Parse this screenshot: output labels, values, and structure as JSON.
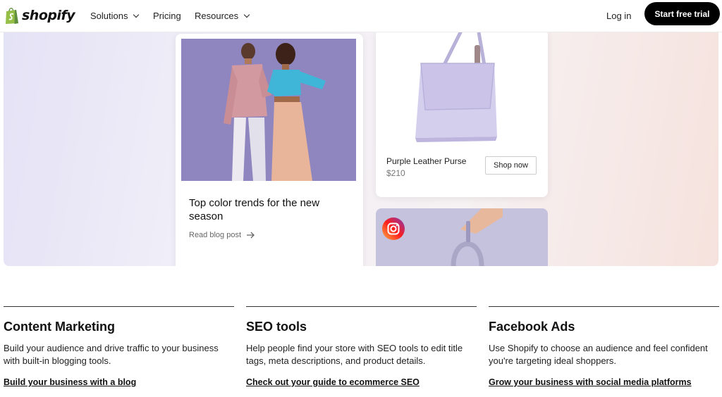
{
  "nav": {
    "logo_text": "shopify",
    "items": [
      {
        "label": "Solutions",
        "has_dropdown": true
      },
      {
        "label": "Pricing",
        "has_dropdown": false
      },
      {
        "label": "Resources",
        "has_dropdown": true
      }
    ],
    "login_label": "Log in",
    "cta_label": "Start free trial"
  },
  "hero": {
    "blog_card": {
      "title": "Top color trends for the new season",
      "link_label": "Read blog post",
      "link_icon": "arrow-right-icon"
    },
    "product_card": {
      "name": "Purple Leather Purse",
      "price": "$210",
      "button_label": "Shop now"
    },
    "instagram_card": {
      "icon": "instagram-icon"
    }
  },
  "features": [
    {
      "title": "Content Marketing",
      "description": "Build your audience and drive traffic to your business with built-in blogging tools.",
      "link": "Build your business with a blog"
    },
    {
      "title": "SEO tools",
      "description": "Help people find your store with SEO tools to edit title tags, meta descriptions, and product details.",
      "link": "Check out your guide to ecommerce SEO"
    },
    {
      "title": "Facebook Ads",
      "description": "Use Shopify to choose an audience and feel confident you're targeting ideal shoppers.",
      "link": "Grow your business with social media platforms"
    }
  ],
  "colors": {
    "brand_green": "#95bf47",
    "cta_bg": "#000000",
    "purse_lavender": "#cfc9ea",
    "photo_bg": "#8f86bf"
  }
}
